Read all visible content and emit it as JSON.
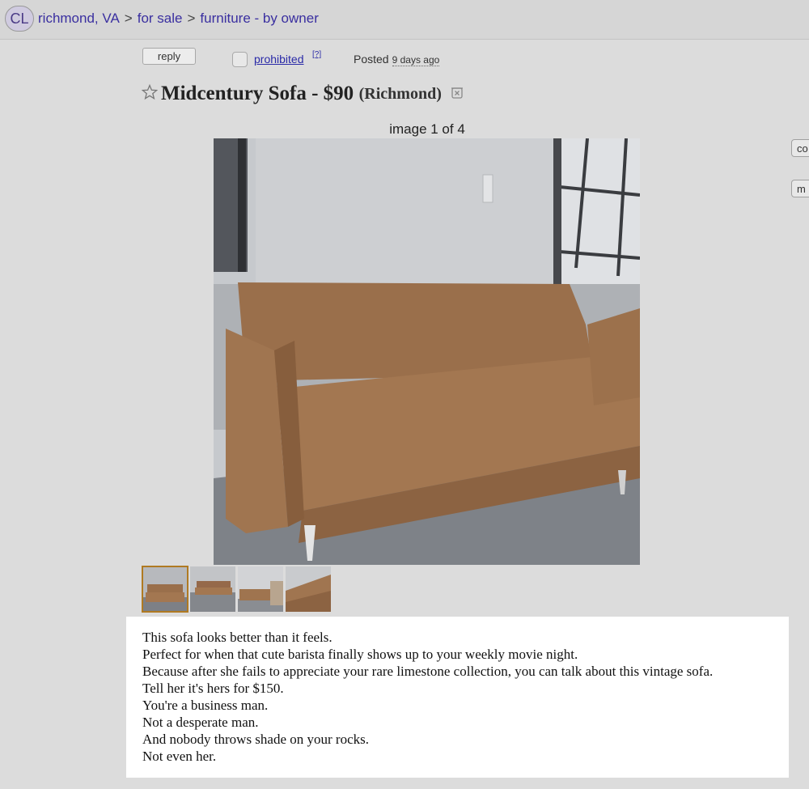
{
  "header": {
    "logo": "CL",
    "breadcrumbs": [
      "richmond, VA",
      "for sale",
      "furniture - by owner"
    ],
    "separator": ">"
  },
  "actions": {
    "reply_label": "reply",
    "prohibited_label": "prohibited",
    "help_label": "[?]",
    "posted_label": "Posted",
    "posted_ago": "9 days ago"
  },
  "posting": {
    "title": "Midcentury Sofa - $90",
    "neighborhood": "(Richmond)",
    "image_counter": "image 1 of 4",
    "body_lines": [
      "This sofa looks better than it feels.",
      "Perfect for when that cute barista finally shows up to your weekly movie night.",
      "Because after she fails to appreciate your rare limestone collection, you can talk about this vintage sofa.",
      "Tell her it's hers for $150.",
      "You're a business man.",
      "Not a desperate man.",
      "And nobody throws shade on your rocks.",
      "Not even her."
    ]
  },
  "side_buttons": [
    "co",
    "m"
  ],
  "icons": {
    "favorite": "star-icon",
    "hide": "hide-icon",
    "flag": "checkbox-icon"
  },
  "colors": {
    "link": "#3a2fa0",
    "background": "#dcdcdc",
    "sofa": "#a07550",
    "thumb_active": "#b07a22"
  }
}
